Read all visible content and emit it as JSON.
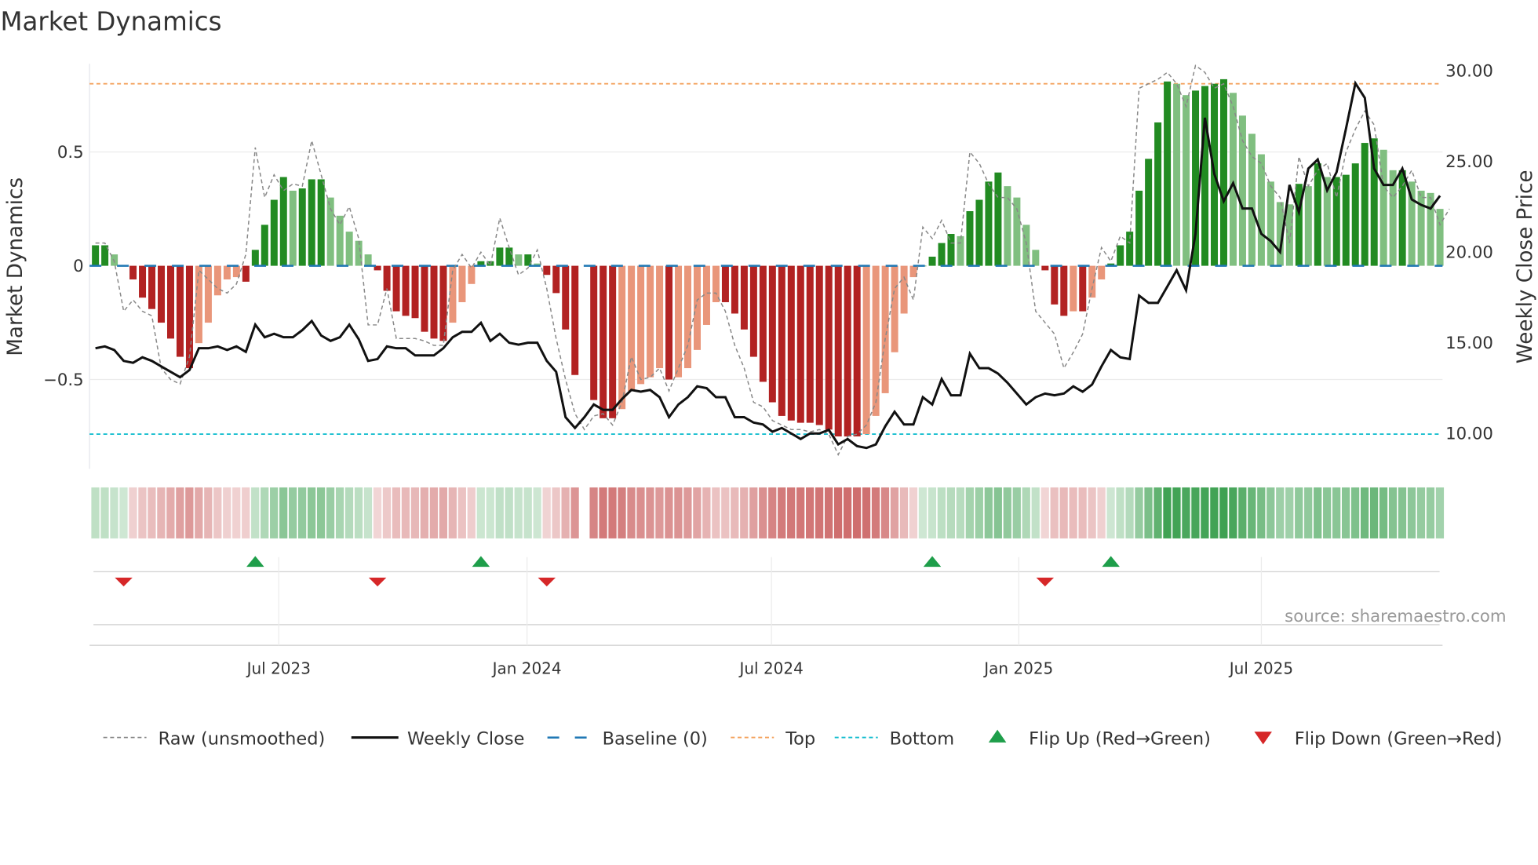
{
  "chart_data": {
    "type": "bar",
    "title": "Market Dynamics",
    "ylabel": "Market Dynamics",
    "y2label": "Weekly Close Price",
    "ylim": [
      -0.9,
      0.88
    ],
    "y2lim": [
      8.1,
      31.3
    ],
    "yticks": [
      {
        "v": 0.5,
        "label": "0.5"
      },
      {
        "v": 0,
        "label": "0"
      },
      {
        "v": -0.5,
        "label": "−0.5"
      }
    ],
    "y2ticks": [
      {
        "v": 30,
        "label": "30.00"
      },
      {
        "v": 25,
        "label": "25.00"
      },
      {
        "v": 20,
        "label": "20.00"
      },
      {
        "v": 15,
        "label": "15.00"
      },
      {
        "v": 10,
        "label": "10.00"
      }
    ],
    "xticks": [
      {
        "week": 19.5,
        "label": "Jul 2023"
      },
      {
        "week": 45.9,
        "label": "Jan 2024"
      },
      {
        "week": 71.9,
        "label": "Jul 2024"
      },
      {
        "week": 98.2,
        "label": "Jan 2025"
      },
      {
        "week": 124.0,
        "label": "Jul 2025"
      }
    ],
    "top": 0.8,
    "bottom": -0.74,
    "momentum": [
      0.09,
      0.09,
      0.05,
      0,
      -0.06,
      -0.14,
      -0.19,
      -0.25,
      -0.32,
      -0.4,
      -0.45,
      -0.34,
      -0.25,
      -0.13,
      -0.06,
      -0.05,
      -0.07,
      0.07,
      0.18,
      0.29,
      0.39,
      0.33,
      0.34,
      0.38,
      0.38,
      0.3,
      0.22,
      0.15,
      0.11,
      0.05,
      -0.02,
      -0.11,
      -0.2,
      -0.22,
      -0.23,
      -0.29,
      -0.32,
      -0.33,
      -0.25,
      -0.16,
      -0.08,
      0.02,
      0.02,
      0.08,
      0.08,
      0.05,
      0.05,
      0.01,
      -0.04,
      -0.12,
      -0.28,
      -0.48,
      null,
      -0.59,
      -0.67,
      -0.67,
      -0.63,
      -0.55,
      -0.52,
      -0.49,
      -0.45,
      -0.5,
      -0.49,
      -0.45,
      -0.37,
      -0.26,
      -0.16,
      -0.16,
      -0.21,
      -0.28,
      -0.4,
      -0.51,
      -0.6,
      -0.66,
      -0.68,
      -0.69,
      -0.69,
      -0.7,
      -0.72,
      -0.75,
      -0.75,
      -0.75,
      -0.74,
      -0.66,
      -0.56,
      -0.38,
      -0.21,
      -0.05,
      0.0,
      0.04,
      0.1,
      0.14,
      0.13,
      0.24,
      0.29,
      0.37,
      0.41,
      0.35,
      0.3,
      0.18,
      0.07,
      -0.02,
      -0.17,
      -0.22,
      -0.2,
      -0.2,
      -0.14,
      -0.06,
      0.01,
      0.09,
      0.15,
      0.33,
      0.47,
      0.63,
      0.81,
      0.8,
      0.75,
      0.77,
      0.79,
      0.8,
      0.82,
      0.76,
      0.66,
      0.58,
      0.49,
      0.37,
      0.28,
      0.27,
      0.36,
      0.35,
      0.45,
      0.39,
      0.39,
      0.4,
      0.45,
      0.54,
      0.56,
      0.51,
      0.42,
      0.42,
      0.37,
      0.33,
      0.32,
      0.25
    ],
    "raw": [
      0.1,
      0.1,
      0.02,
      -0.2,
      -0.15,
      -0.2,
      -0.22,
      -0.45,
      -0.5,
      -0.52,
      -0.4,
      -0.02,
      -0.06,
      -0.1,
      -0.12,
      -0.08,
      0.05,
      0.52,
      0.3,
      0.4,
      0.33,
      0.36,
      0.35,
      0.55,
      0.4,
      0.25,
      0.18,
      0.26,
      0.12,
      -0.26,
      -0.26,
      -0.1,
      -0.32,
      -0.32,
      -0.32,
      -0.33,
      -0.35,
      -0.35,
      -0.02,
      0.05,
      -0.01,
      0.06,
      0.0,
      0.21,
      0.08,
      -0.04,
      -0.01,
      0.07,
      -0.1,
      -0.32,
      -0.5,
      -0.65,
      -0.72,
      -0.66,
      -0.65,
      -0.7,
      -0.6,
      -0.4,
      -0.5,
      -0.49,
      -0.45,
      -0.55,
      -0.45,
      -0.35,
      -0.15,
      -0.12,
      -0.12,
      -0.2,
      -0.35,
      -0.45,
      -0.6,
      -0.62,
      -0.68,
      -0.7,
      -0.72,
      -0.72,
      -0.73,
      -0.72,
      -0.74,
      -0.83,
      -0.75,
      -0.74,
      -0.7,
      -0.6,
      -0.32,
      -0.1,
      -0.05,
      -0.15,
      0.17,
      0.12,
      0.2,
      0.1,
      0.1,
      0.5,
      0.45,
      0.36,
      0.3,
      0.3,
      0.25,
      0.1,
      -0.2,
      -0.25,
      -0.3,
      -0.45,
      -0.38,
      -0.3,
      -0.1,
      0.08,
      0.02,
      0.13,
      0.1,
      0.78,
      0.8,
      0.82,
      0.85,
      0.8,
      0.7,
      0.88,
      0.85,
      0.78,
      0.8,
      0.7,
      0.55,
      0.48,
      0.45,
      0.35,
      0.3,
      0.1,
      0.48,
      0.35,
      0.42,
      0.45,
      0.3,
      0.5,
      0.6,
      0.68,
      0.62,
      0.35,
      0.3,
      0.35,
      0.42,
      0.3,
      0.3,
      0.18,
      0.25
    ],
    "close": [
      14.7,
      14.8,
      14.6,
      14.0,
      13.9,
      14.2,
      14.0,
      13.7,
      13.4,
      13.1,
      13.5,
      14.7,
      14.7,
      14.8,
      14.6,
      14.8,
      14.5,
      16.0,
      15.3,
      15.5,
      15.3,
      15.3,
      15.7,
      16.2,
      15.4,
      15.1,
      15.3,
      16.0,
      15.2,
      14.0,
      14.1,
      14.8,
      14.7,
      14.7,
      14.3,
      14.3,
      14.3,
      14.7,
      15.3,
      15.6,
      15.6,
      16.1,
      15.1,
      15.5,
      15.0,
      14.9,
      15.0,
      15.0,
      14.0,
      13.4,
      10.9,
      10.3,
      10.9,
      11.6,
      11.3,
      11.3,
      11.9,
      12.4,
      12.3,
      12.4,
      12.0,
      10.9,
      11.6,
      12.0,
      12.6,
      12.5,
      12.0,
      12.0,
      10.9,
      10.9,
      10.6,
      10.5,
      10.1,
      10.3,
      10.0,
      9.7,
      10.0,
      10.0,
      10.2,
      9.4,
      9.7,
      9.3,
      9.2,
      9.4,
      10.4,
      11.2,
      10.5,
      10.5,
      12.0,
      11.6,
      13.0,
      12.1,
      12.1,
      14.4,
      13.6,
      13.6,
      13.3,
      12.8,
      12.2,
      11.6,
      12.0,
      12.2,
      12.1,
      12.2,
      12.6,
      12.3,
      12.7,
      13.7,
      14.6,
      14.2,
      14.1,
      17.6,
      17.2,
      17.2,
      18.1,
      19.0,
      17.9,
      21.0,
      27.4,
      24.3,
      22.8,
      23.8,
      22.4,
      22.4,
      21.0,
      20.6,
      20.0,
      23.7,
      22.2,
      24.6,
      25.1,
      23.4,
      24.4,
      26.8,
      29.3,
      28.5,
      24.6,
      23.7,
      23.7,
      24.6,
      22.9,
      22.6,
      22.4,
      23.1
    ],
    "flips_up": [
      17,
      41,
      89,
      108
    ],
    "flips_down": [
      3,
      30,
      48,
      101
    ],
    "legend": [
      "Raw (unsmoothed)",
      "Weekly Close",
      "Baseline (0)",
      "Top",
      "Bottom",
      "Flip Up (Red→Green)",
      "Flip Down (Green→Red)"
    ],
    "legend_placement": "bottom",
    "colors": {
      "green_dark": "#228b22",
      "green_light": "#80bf80",
      "red_dark": "#b22222",
      "red_light": "#e9967a",
      "baseline": "#1f77b4",
      "top": "#f4a460",
      "bottom": "#17becf",
      "flip_up": "#1e9e4a",
      "flip_down": "#d62728"
    }
  },
  "source": "source: sharemaestro.com"
}
